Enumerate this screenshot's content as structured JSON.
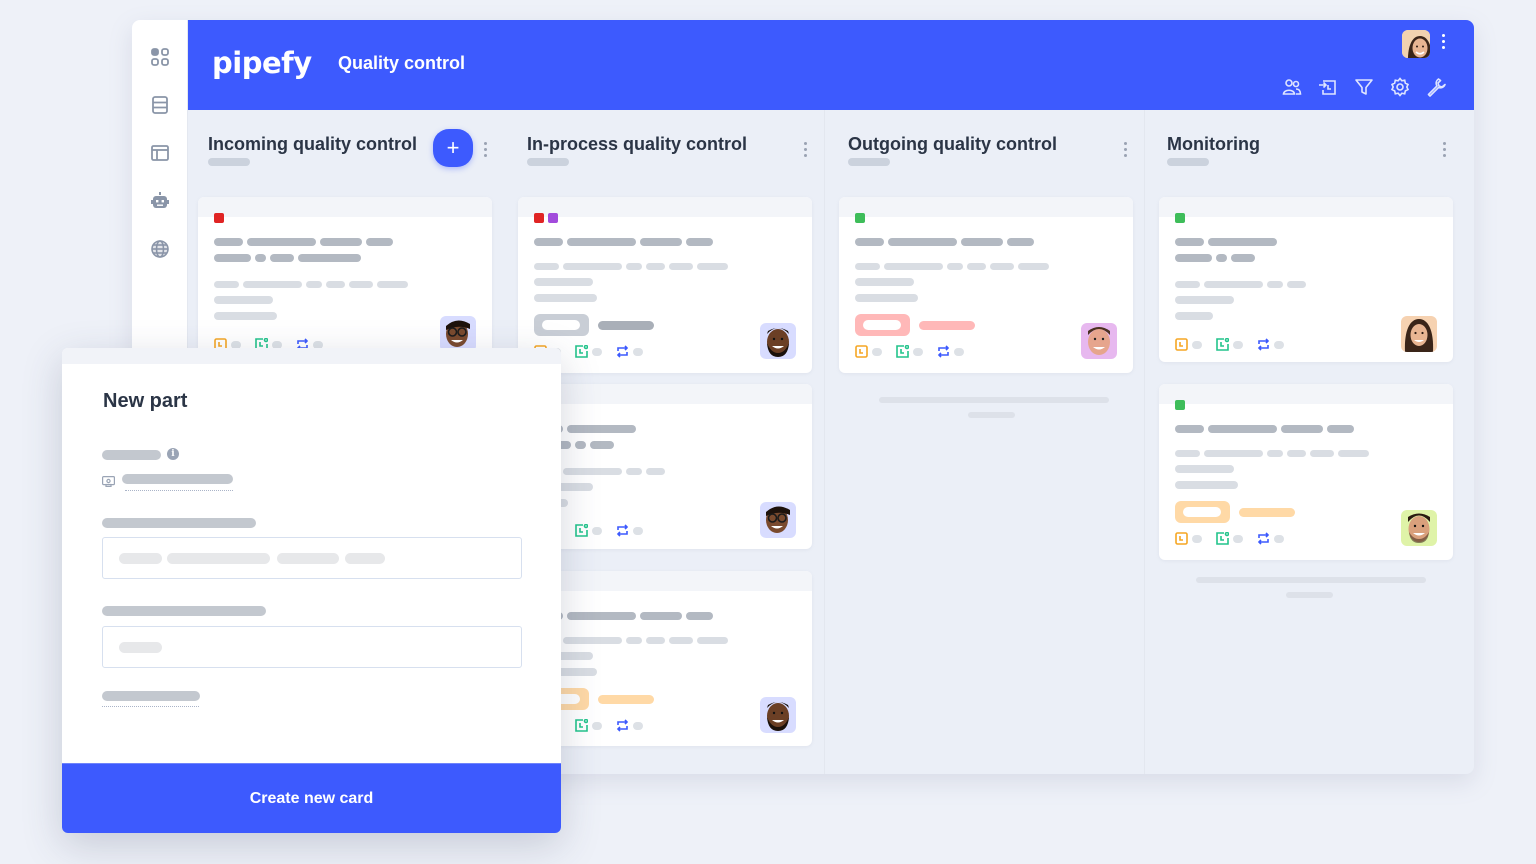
{
  "app": {
    "logo": "pipefy",
    "pipe_title": "Quality control",
    "colors": {
      "brand": "#3d5afe",
      "orange": "#f5a623",
      "green": "#22c48b",
      "blue": "#3d5afe",
      "red": "#e02424",
      "purple": "#a24bdc",
      "label_green": "#3ebd5a",
      "pink_tag": "#ffb8b8",
      "peach_tag": "#ffd9a6",
      "gray_tag": "#c9ced6"
    }
  },
  "sidebar": {
    "items": [
      {
        "icon": "grid-icon"
      },
      {
        "icon": "database-icon"
      },
      {
        "icon": "layout-icon"
      },
      {
        "icon": "robot-icon"
      },
      {
        "icon": "globe-icon"
      }
    ]
  },
  "toolbar": {
    "icons": [
      "members-icon",
      "import-icon",
      "filter-icon",
      "settings-icon",
      "wrench-icon"
    ]
  },
  "phases": [
    {
      "title": "Incoming quality control",
      "has_add": true
    },
    {
      "title": "In-process quality control",
      "has_add": false
    },
    {
      "title": "Outgoing quality control",
      "has_add": false
    },
    {
      "title": "Monitoring",
      "has_add": false
    }
  ],
  "modal": {
    "title": "New part",
    "submit_label": "Create new card",
    "add_button_label": "+"
  }
}
